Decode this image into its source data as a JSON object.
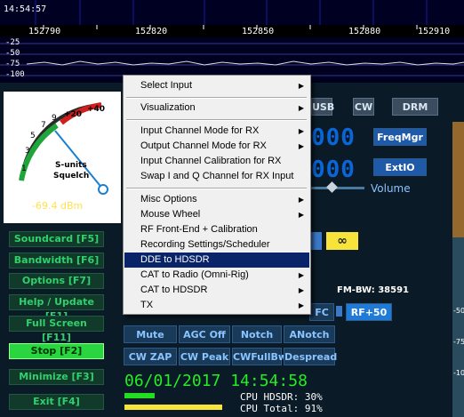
{
  "spectrum": {
    "time": "14:54:57",
    "freq_labels": [
      "152790",
      "152820",
      "152850",
      "152880",
      "152910"
    ],
    "db_labels": [
      "-25",
      "-50",
      "-75",
      "-100"
    ]
  },
  "smeter": {
    "scale_labels": [
      "1",
      "3",
      "5",
      "7",
      "9",
      "+20",
      "+40"
    ],
    "label1": "S-units",
    "label2": "Squelch",
    "dbm": "-69.4 dBm"
  },
  "side_buttons": [
    {
      "label": "Soundcard  [F5]"
    },
    {
      "label": "Bandwidth  [F6]"
    },
    {
      "label": "Options    [F7]"
    },
    {
      "label": "Help / Update  [F1]"
    },
    {
      "label": "Full Screen  [F11]"
    },
    {
      "label": "Stop          [F2]"
    },
    {
      "label": "Minimize   [F3]"
    },
    {
      "label": "Exit          [F4]"
    }
  ],
  "modes": {
    "usb": "USB",
    "cw": "CW",
    "drm": "DRM"
  },
  "freq_digits": {
    "upper": "000",
    "lower": "000"
  },
  "right_buttons": {
    "freqmgr": "FreqMgr",
    "extio": "ExtIO"
  },
  "volume_label": "Volume",
  "infinity_label": "∞",
  "fm_bw": "FM-BW: 38591",
  "afc_partial": "FC",
  "rf_button": "RF+50",
  "dsp_buttons": [
    {
      "label": "Mute"
    },
    {
      "label": "AGC Off"
    },
    {
      "label": "Notch"
    },
    {
      "label": "ANotch"
    },
    {
      "label": "CW ZAP"
    },
    {
      "label": "CW Peak"
    },
    {
      "label": "CWFullBw"
    },
    {
      "label": "Despread"
    }
  ],
  "date_time": "06/01/2017 14:54:58",
  "cpu": {
    "hdsdr": "CPU HDSDR:  30%",
    "total": "CPU Total:  91%"
  },
  "right_scale": [
    "-50",
    "-75",
    "-100"
  ],
  "menu": {
    "items": [
      {
        "label": "Select Input",
        "submenu": true
      },
      {
        "label": "Visualization",
        "submenu": true
      },
      {
        "label": "Input Channel Mode for RX",
        "submenu": true
      },
      {
        "label": "Output Channel Mode for RX",
        "submenu": true
      },
      {
        "label": "Input Channel Calibration for RX",
        "submenu": false
      },
      {
        "label": "Swap I and Q Channel for RX Input",
        "submenu": false
      },
      {
        "label": "Misc Options",
        "submenu": true
      },
      {
        "label": "Mouse Wheel",
        "submenu": true
      },
      {
        "label": "RF Front-End + Calibration",
        "submenu": false
      },
      {
        "label": "Recording Settings/Scheduler",
        "submenu": false
      },
      {
        "label": "DDE to HDSDR",
        "submenu": false
      },
      {
        "label": "CAT to Radio (Omni-Rig)",
        "submenu": true
      },
      {
        "label": "CAT to HDSDR",
        "submenu": true
      },
      {
        "label": "TX",
        "submenu": true
      }
    ],
    "arrow_glyph": "▶"
  },
  "colors": {
    "accent_green": "#2fd16c",
    "menu_highlight": "#0a246a",
    "dsp_blue": "#8ac4ff"
  }
}
